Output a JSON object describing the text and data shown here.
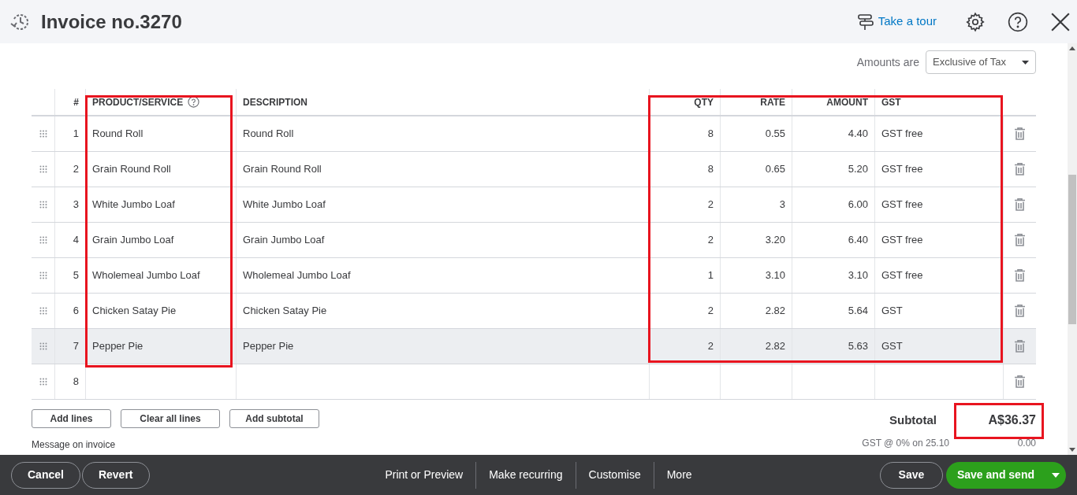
{
  "header": {
    "title": "Invoice no.3270",
    "tour_link": "Take a tour"
  },
  "amounts_are": {
    "label": "Amounts are",
    "value": "Exclusive of Tax"
  },
  "table": {
    "columns": [
      "#",
      "PRODUCT/SERVICE",
      "DESCRIPTION",
      "QTY",
      "RATE",
      "AMOUNT",
      "GST"
    ],
    "rows": [
      {
        "cells": [
          "1",
          "Round Roll",
          "Round Roll",
          "8",
          "0.55",
          "4.40",
          "GST free"
        ],
        "selected": false
      },
      {
        "cells": [
          "2",
          "Grain Round Roll",
          "Grain Round Roll",
          "8",
          "0.65",
          "5.20",
          "GST free"
        ],
        "selected": false
      },
      {
        "cells": [
          "3",
          "White Jumbo Loaf",
          "White Jumbo Loaf",
          "2",
          "3",
          "6.00",
          "GST free"
        ],
        "selected": false
      },
      {
        "cells": [
          "4",
          "Grain Jumbo Loaf",
          "Grain Jumbo Loaf",
          "2",
          "3.20",
          "6.40",
          "GST free"
        ],
        "selected": false
      },
      {
        "cells": [
          "5",
          "Wholemeal Jumbo Loaf",
          "Wholemeal Jumbo Loaf",
          "1",
          "3.10",
          "3.10",
          "GST free"
        ],
        "selected": false
      },
      {
        "cells": [
          "6",
          "Chicken Satay Pie",
          "Chicken Satay Pie",
          "2",
          "2.82",
          "5.64",
          "GST"
        ],
        "selected": false
      },
      {
        "cells": [
          "7",
          "Pepper Pie",
          "Pepper Pie",
          "2",
          "2.82",
          "5.63",
          "GST"
        ],
        "selected": true
      },
      {
        "cells": [
          "8"
        ],
        "selected": false
      }
    ]
  },
  "line_buttons": [
    "Add lines",
    "Clear all lines",
    "Add subtotal"
  ],
  "message_label": "Message on invoice",
  "totals": [
    {
      "kind": "subtotal",
      "label": "Subtotal",
      "value": "A$36.37"
    },
    {
      "kind": "tax",
      "label": "GST @ 0% on 25.10",
      "value": "0.00"
    }
  ],
  "footer": {
    "left": [
      "Cancel",
      "Revert"
    ],
    "center": [
      "Print or Preview",
      "Make recurring",
      "Customise",
      "More"
    ],
    "right": [
      {
        "kind": "secondary",
        "label": "Save"
      },
      {
        "kind": "primary",
        "label": "Save and send"
      }
    ]
  }
}
